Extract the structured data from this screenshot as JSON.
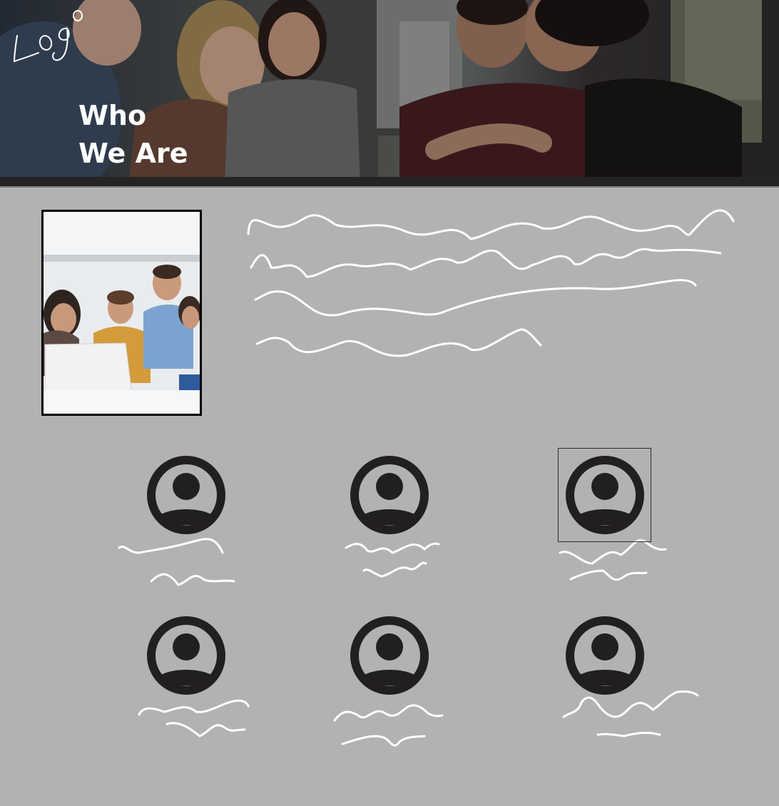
{
  "header": {
    "logo_text": "Logo",
    "title_line1": "Who",
    "title_line2": "We Are"
  },
  "icons": {
    "logo": "logo-scribble-icon",
    "member": "user-avatar-icon"
  },
  "colors": {
    "page_background": "#b2b2b2",
    "avatar": "#221f20",
    "scribble": "#ffffff",
    "title": "#ffffff"
  },
  "team": {
    "members": [
      {
        "icon": "user-avatar-icon",
        "selected": false
      },
      {
        "icon": "user-avatar-icon",
        "selected": false
      },
      {
        "icon": "user-avatar-icon",
        "selected": true
      },
      {
        "icon": "user-avatar-icon",
        "selected": false
      },
      {
        "icon": "user-avatar-icon",
        "selected": false
      },
      {
        "icon": "user-avatar-icon",
        "selected": false
      }
    ]
  }
}
